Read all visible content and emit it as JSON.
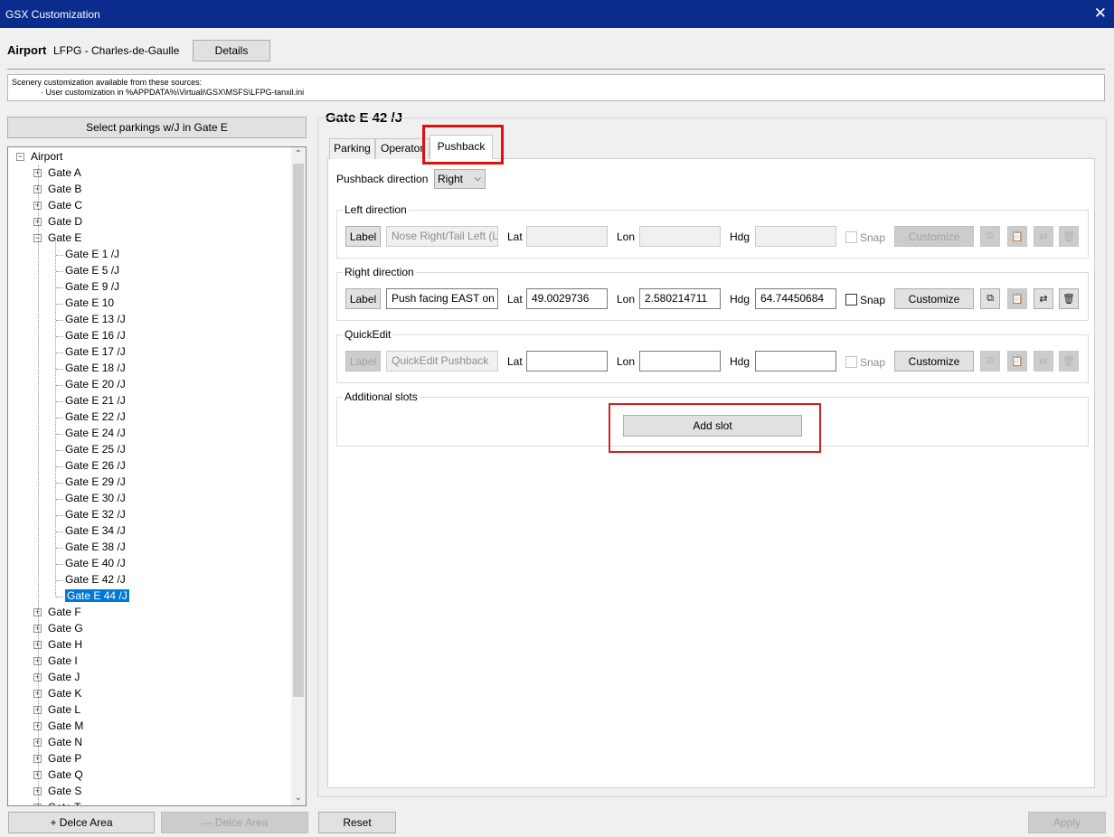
{
  "window": {
    "title": "GSX Customization"
  },
  "airport": {
    "label": "Airport",
    "name": "LFPG - Charles-de-Gaulle",
    "details_button": "Details"
  },
  "sources": {
    "line1": "Scenery customization available from these sources:",
    "line2": "· User customization in %APPDATA%\\Virtuali\\GSX\\MSFS\\LFPG-tanxil.ini"
  },
  "select_button": "Select parkings w/J in Gate E",
  "tree": {
    "root": "Airport",
    "gates_before": [
      "Gate A",
      "Gate B",
      "Gate C",
      "Gate D"
    ],
    "expanded": "Gate E",
    "children": [
      "Gate E 1 /J",
      "Gate E 5 /J",
      "Gate E 9 /J",
      "Gate E 10",
      "Gate E 13 /J",
      "Gate E 16 /J",
      "Gate E 17 /J",
      "Gate E 18 /J",
      "Gate E 20 /J",
      "Gate E 21 /J",
      "Gate E 22 /J",
      "Gate E 24 /J",
      "Gate E 25 /J",
      "Gate E 26 /J",
      "Gate E 29 /J",
      "Gate E 30 /J",
      "Gate E 32 /J",
      "Gate E 34 /J",
      "Gate E 38 /J",
      "Gate E 40 /J",
      "Gate E 42 /J",
      "Gate E 44 /J"
    ],
    "selected": "Gate E 44 /J",
    "gates_after": [
      "Gate F",
      "Gate G",
      "Gate H",
      "Gate I",
      "Gate J",
      "Gate K",
      "Gate L",
      "Gate M",
      "Gate N",
      "Gate P",
      "Gate Q",
      "Gate S",
      "Gate T"
    ]
  },
  "footer": {
    "add_area": "+ Delce Area",
    "remove_area": "— Delce Area",
    "reset": "Reset",
    "apply": "Apply"
  },
  "panel": {
    "title": "Gate E 42 /J",
    "tabs": [
      "Parking",
      "Operator",
      "Pushback"
    ],
    "active_tab": "Pushback",
    "pushback_direction_label": "Pushback direction",
    "pushback_direction_value": "Right"
  },
  "groups": {
    "left": {
      "title": "Left direction",
      "label_btn": "Label",
      "label_value": "Nose Right/Tail Left (L",
      "lat": "",
      "lon": "",
      "hdg": "",
      "customize": "Customize"
    },
    "right": {
      "title": "Right direction",
      "label_btn": "Label",
      "label_value": "Push facing EAST on F",
      "lat": "49.0029736",
      "lon": "2.580214711",
      "hdg": "64.74450684",
      "customize": "Customize"
    },
    "quick": {
      "title": "QuickEdit",
      "label_btn": "Label",
      "label_value": "QuickEdit Pushback",
      "lat": "",
      "lon": "",
      "hdg": "",
      "customize": "Customize"
    },
    "additional": {
      "title": "Additional slots",
      "add_slot": "Add slot"
    }
  },
  "field_labels": {
    "lat": "Lat",
    "lon": "Lon",
    "hdg": "Hdg",
    "snap": "Snap"
  },
  "icons": {
    "copy": "copy-icon",
    "paste": "clipboard-icon",
    "swap": "swap-icon",
    "delete": "trash-icon"
  }
}
